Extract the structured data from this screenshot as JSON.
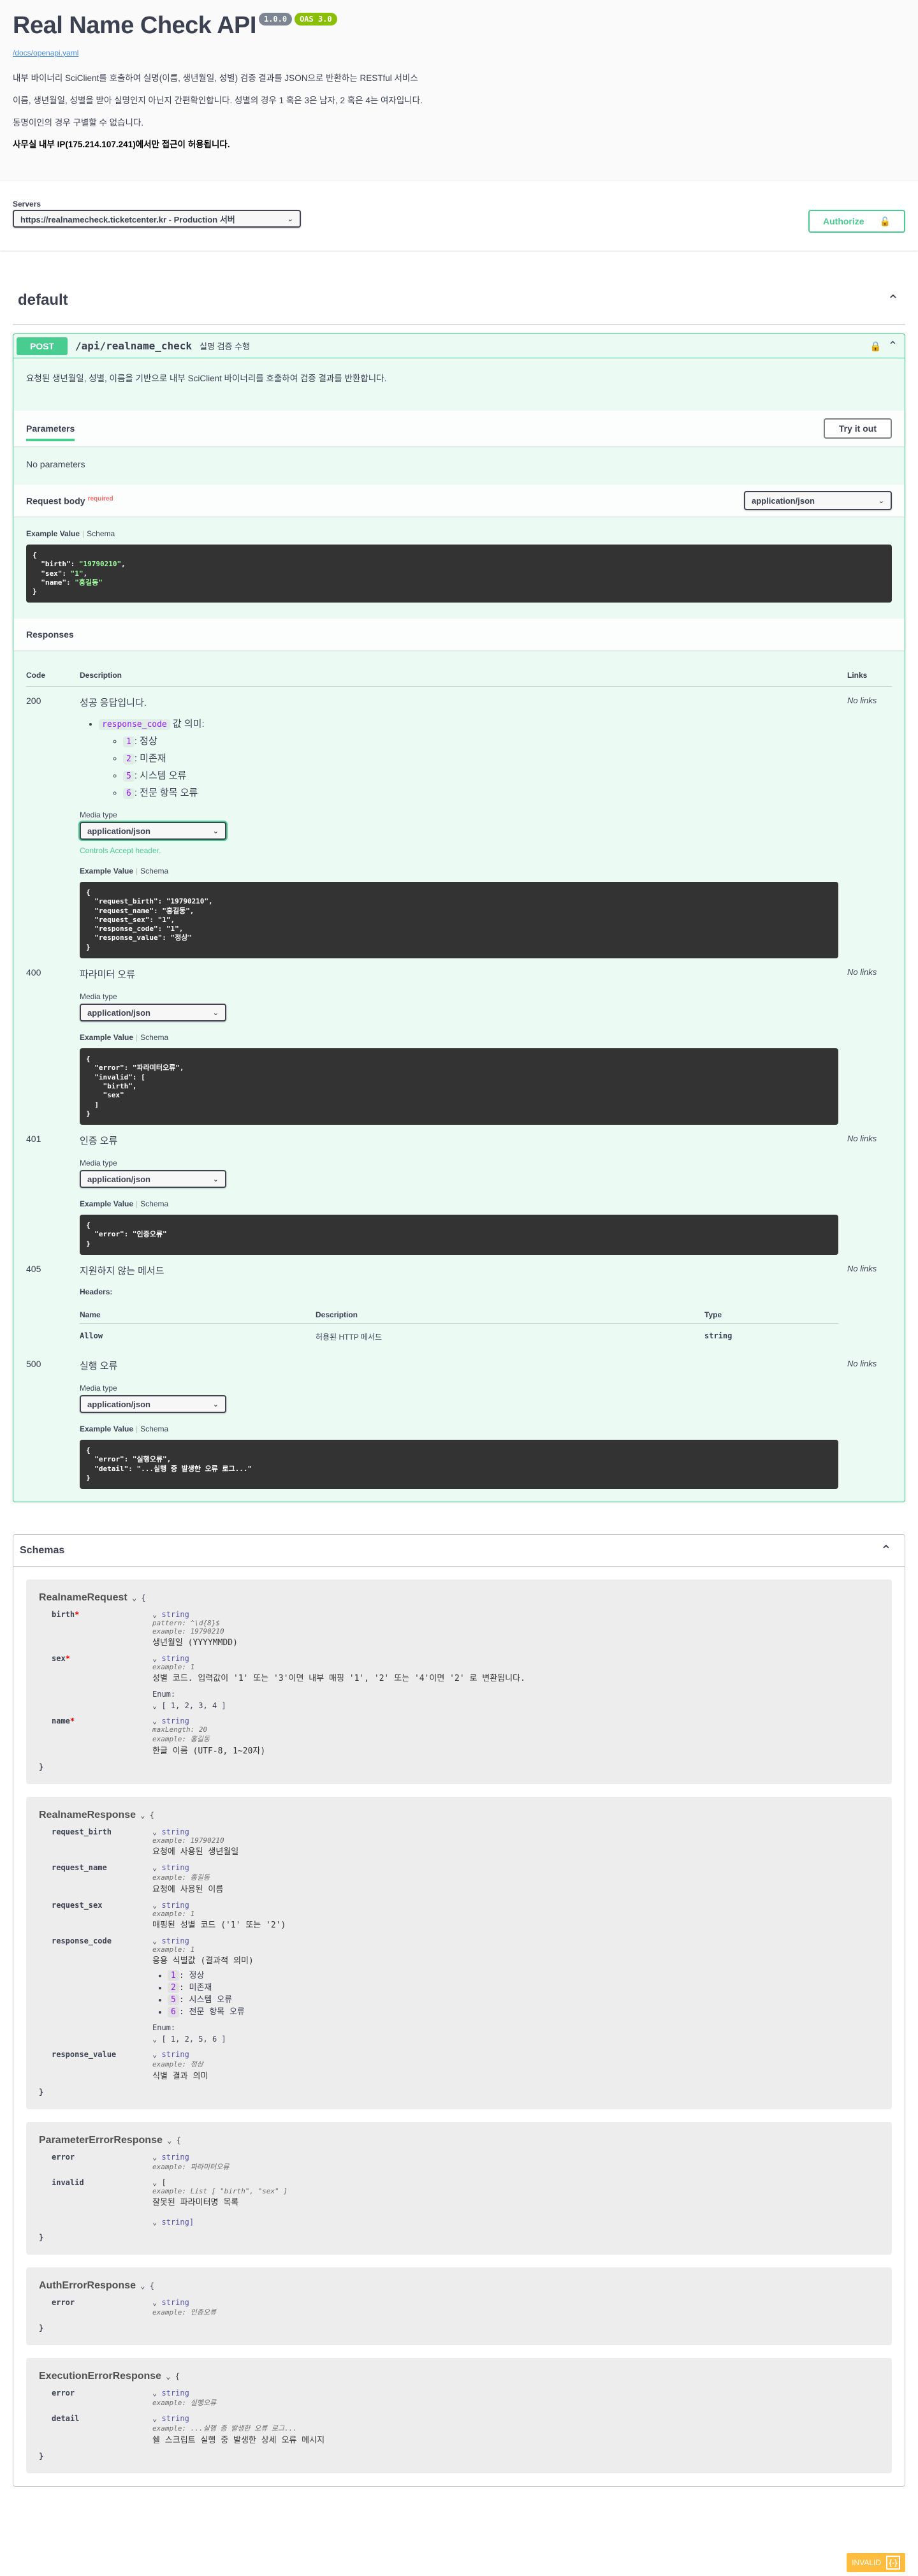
{
  "info": {
    "title": "Real Name Check API",
    "version": "1.0.0",
    "oas": "OAS 3.0",
    "spec_url": "/docs/openapi.yaml",
    "desc1": "내부 바이너리 SciClient를 호출하여 실명(이름, 생년월일, 성별) 검증 결과를 JSON으로 반환하는 RESTful 서비스",
    "desc2": "이름, 생년월일, 성별을 받아 실명인지 아닌지 간편확인합니다. 성별의 경우 1 혹은 3은 남자, 2 혹은 4는 여자입니다.",
    "desc3": "동명이인의 경우 구별할 수 없습니다.",
    "desc4": "사무실 내부 IP(175.214.107.241)에서만 접근이 허용됩니다."
  },
  "servers": {
    "label": "Servers",
    "selected": "https://realnamecheck.ticketcenter.kr - Production 서버",
    "authorize_label": "Authorize"
  },
  "tag": {
    "name": "default"
  },
  "operation": {
    "method": "POST",
    "path": "/api/realname_check",
    "summary": "실명 검증 수행",
    "description": "요청된 생년월일, 성별, 이름을 기반으로 내부 SciClient 바이너리를 호출하여 검증 결과를 반환합니다.",
    "parameters_label": "Parameters",
    "try_label": "Try it out",
    "no_params": "No parameters",
    "request_body_label": "Request body",
    "required_label": "required",
    "content_type": "application/json",
    "example_value": "Example Value",
    "schema_tab": "Schema",
    "request_example": {
      "l1": "{",
      "k_birth": "  \"birth\": ",
      "v_birth": "\"19790210\"",
      "k_sex": "  \"sex\": ",
      "v_sex": "\"1\"",
      "k_name": "  \"name\": ",
      "v_name": "\"홍길동\"",
      "l5": "}"
    }
  },
  "responses": {
    "title": "Responses",
    "col_code": "Code",
    "col_desc": "Description",
    "col_links": "Links",
    "no_links": "No links",
    "media_type_label": "Media type",
    "controls_hint": "Controls Accept header.",
    "r200": {
      "code": "200",
      "title": "성공 응답입니다.",
      "bullet_code": "response_code",
      "bullet_text": " 값 의미:",
      "items": [
        {
          "code": "1",
          "text": ": 정상"
        },
        {
          "code": "2",
          "text": ": 미존재"
        },
        {
          "code": "5",
          "text": ": 시스템 오류"
        },
        {
          "code": "6",
          "text": ": 전문 항목 오류"
        }
      ],
      "example": "{\n  \"request_birth\": \"19790210\",\n  \"request_name\": \"홍길동\",\n  \"request_sex\": \"1\",\n  \"response_code\": \"1\",\n  \"response_value\": \"정상\"\n}"
    },
    "r400": {
      "code": "400",
      "title": "파라미터 오류",
      "example": "{\n  \"error\": \"파라미터오류\",\n  \"invalid\": [\n    \"birth\",\n    \"sex\"\n  ]\n}"
    },
    "r401": {
      "code": "401",
      "title": "인증 오류",
      "example": "{\n  \"error\": \"인증오류\"\n}"
    },
    "r405": {
      "code": "405",
      "title": "지원하지 않는 메서드",
      "headers_label": "Headers:",
      "h_name": "Name",
      "h_desc": "Description",
      "h_type": "Type",
      "row_name": "Allow",
      "row_desc": "허용된 HTTP 메서드",
      "row_type": "string"
    },
    "r500": {
      "code": "500",
      "title": "실행 오류",
      "example": "{\n  \"error\": \"실행오류\",\n  \"detail\": \"...실행 중 발생한 오류 로그...\"\n}"
    }
  },
  "schemas": {
    "title": "Schemas",
    "enum_label": "Enum:",
    "m1": {
      "name": "RealnameRequest",
      "p1": {
        "name": "birth",
        "type": "string",
        "meta1": "pattern: ^\\d{8}$",
        "meta2": "example: 19790210",
        "desc": "생년월일 (YYYYMMDD)"
      },
      "p2": {
        "name": "sex",
        "type": "string",
        "meta1": "example: 1",
        "desc": "성별 코드. 입력값이 '1' 또는 '3'이면 내부 매핑 '1', '2' 또는 '4'이면 '2' 로 변환됩니다.",
        "enum": "[ 1, 2, 3, 4 ]"
      },
      "p3": {
        "name": "name",
        "type": "string",
        "meta1": "maxLength: 20",
        "meta2": "example: 홍길동",
        "desc": "한글 이름 (UTF-8, 1~20자)"
      }
    },
    "m2": {
      "name": "RealnameResponse",
      "p1": {
        "name": "request_birth",
        "type": "string",
        "meta1": "example: 19790210",
        "desc": "요청에 사용된 생년월일"
      },
      "p2": {
        "name": "request_name",
        "type": "string",
        "meta1": "example: 홍길동",
        "desc": "요청에 사용된 이름"
      },
      "p3": {
        "name": "request_sex",
        "type": "string",
        "meta1": "example: 1",
        "desc": "매핑된 성별 코드 ('1' 또는 '2')"
      },
      "p4": {
        "name": "response_code",
        "type": "string",
        "meta1": "example: 1",
        "desc": "응용 식별값 (결과적 의미)",
        "items": [
          {
            "code": "1",
            "text": ": 정상"
          },
          {
            "code": "2",
            "text": ": 미존재"
          },
          {
            "code": "5",
            "text": ": 시스템 오류"
          },
          {
            "code": "6",
            "text": ": 전문 항목 오류"
          }
        ],
        "enum": "[ 1, 2, 5, 6 ]"
      },
      "p5": {
        "name": "response_value",
        "type": "string",
        "meta1": "example: 정상",
        "desc": "식별 결과 의미"
      }
    },
    "m3": {
      "name": "ParameterErrorResponse",
      "p1": {
        "name": "error",
        "type": "string",
        "meta1": "example: 파라미터오류"
      },
      "p2": {
        "name": "invalid",
        "type": "[",
        "meta1": "example: List [ \"birth\", \"sex\" ]",
        "desc": "잘못된 파라미터명 목록",
        "close": "string]"
      }
    },
    "m4": {
      "name": "AuthErrorResponse",
      "p1": {
        "name": "error",
        "type": "string",
        "meta1": "example: 인증오류"
      }
    },
    "m5": {
      "name": "ExecutionErrorResponse",
      "p1": {
        "name": "error",
        "type": "string",
        "meta1": "example: 실행오류"
      },
      "p2": {
        "name": "detail",
        "type": "string",
        "meta1": "example: ...실행 중 발생한 오류 로그...",
        "desc": "쉘 스크립트 실행 중 발생한 상세 오류 메시지"
      }
    }
  },
  "footer": {
    "label": "INVALID",
    "box": "{-}"
  }
}
